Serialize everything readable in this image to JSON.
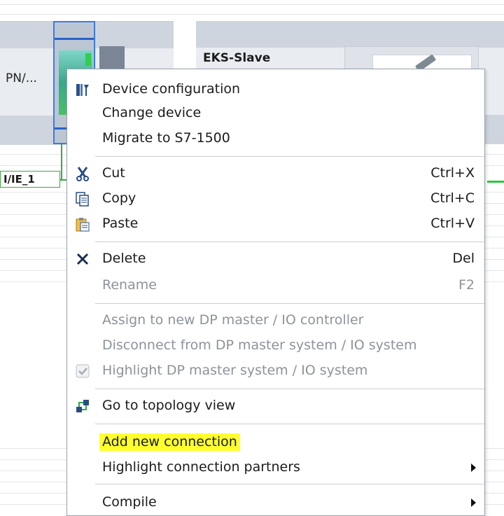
{
  "canvas": {
    "left_device_label": "PN/...",
    "right_device_title": "EKS-Slave",
    "network_label": "I/IE_1"
  },
  "menu": {
    "groups": [
      [
        {
          "label": "Device configuration",
          "icon": "device-config-icon",
          "enabled": true
        },
        {
          "label": "Change device",
          "enabled": true
        },
        {
          "label": "Migrate to S7-1500",
          "enabled": true
        }
      ],
      [
        {
          "label": "Cut",
          "shortcut": "Ctrl+X",
          "icon": "scissors-icon",
          "enabled": true
        },
        {
          "label": "Copy",
          "shortcut": "Ctrl+C",
          "icon": "copy-icon",
          "enabled": true
        },
        {
          "label": "Paste",
          "shortcut": "Ctrl+V",
          "icon": "paste-icon",
          "enabled": true
        }
      ],
      [
        {
          "label": "Delete",
          "shortcut": "Del",
          "icon": "delete-x-icon",
          "enabled": true
        },
        {
          "label": "Rename",
          "shortcut": "F2",
          "enabled": false
        }
      ],
      [
        {
          "label": "Assign to new DP master / IO controller",
          "enabled": false
        },
        {
          "label": "Disconnect from DP master system / IO system",
          "enabled": false
        },
        {
          "label": "Highlight DP master system / IO system",
          "icon": "checkbox-checked-icon",
          "enabled": false
        }
      ],
      [
        {
          "label": "Go to topology view",
          "icon": "topology-icon",
          "enabled": true
        }
      ],
      [
        {
          "label": "Add new connection",
          "enabled": true,
          "highlighted": true,
          "highlight_color": "#ffff2e"
        },
        {
          "label": "Highlight connection partners",
          "enabled": true,
          "submenu": true
        }
      ],
      [
        {
          "label": "Compile",
          "enabled": true,
          "submenu": true
        }
      ]
    ]
  }
}
